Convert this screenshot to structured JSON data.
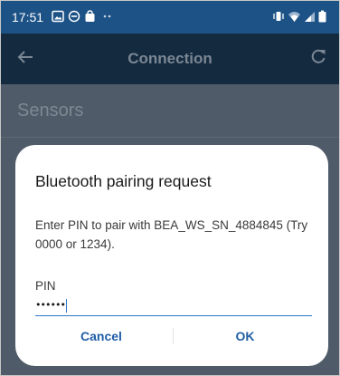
{
  "status_bar": {
    "time": "17:51",
    "left_icons": [
      "gallery-icon",
      "do-not-disturb-icon",
      "bag-icon",
      "more-dots-icon"
    ],
    "right_icons": [
      "vibrate-icon",
      "wifi-icon",
      "signal-icon",
      "battery-icon"
    ],
    "color": "#1c5286"
  },
  "app_bar": {
    "title": "Connection",
    "back_icon": "arrow-left-icon",
    "refresh_icon": "refresh-icon",
    "color": "#142a3f"
  },
  "content": {
    "section_heading": "Sensors"
  },
  "dialog": {
    "title": "Bluetooth pairing request",
    "message": "Enter PIN to pair with BEA_WS_SN_4884845 (Try 0000 or 1234).",
    "pin_label": "PIN",
    "pin_value": "••••••",
    "cancel_label": "Cancel",
    "ok_label": "OK",
    "accent_color": "#1f5ea6"
  }
}
